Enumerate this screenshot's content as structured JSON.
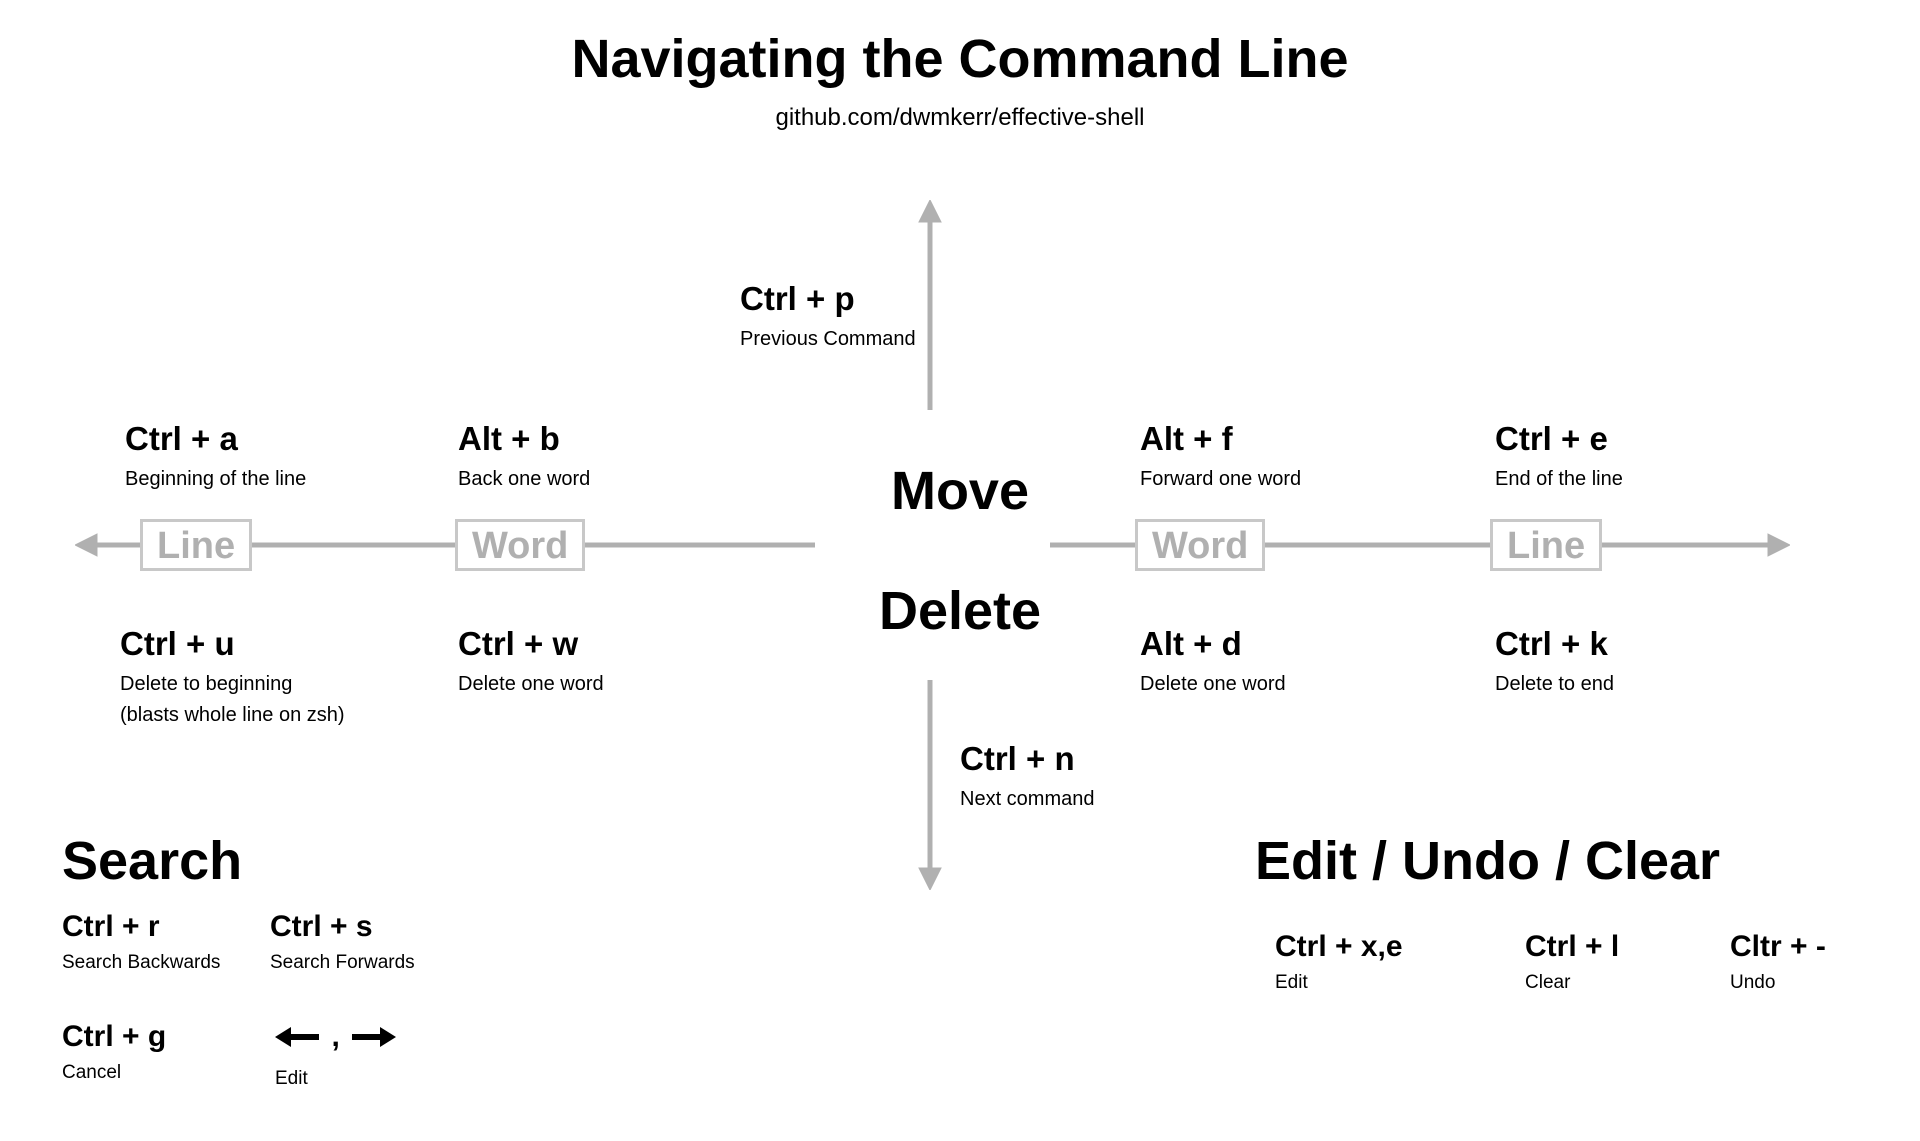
{
  "header": {
    "title": "Navigating the Command Line",
    "subtitle": "github.com/dwmkerr/effective-shell"
  },
  "center": {
    "move": "Move",
    "delete": "Delete"
  },
  "axis_labels": {
    "left_line": "Line",
    "left_word": "Word",
    "right_word": "Word",
    "right_line": "Line"
  },
  "shortcuts": {
    "ctrl_p": {
      "key": "Ctrl + p",
      "desc": "Previous Command"
    },
    "ctrl_n": {
      "key": "Ctrl + n",
      "desc": "Next command"
    },
    "ctrl_a": {
      "key": "Ctrl + a",
      "desc": "Beginning of the line"
    },
    "alt_b": {
      "key": "Alt + b",
      "desc": "Back one word"
    },
    "alt_f": {
      "key": "Alt + f",
      "desc": "Forward one word"
    },
    "ctrl_e": {
      "key": "Ctrl + e",
      "desc": "End of the line"
    },
    "ctrl_u": {
      "key": "Ctrl + u",
      "desc": "Delete to beginning",
      "desc2": "(blasts whole line on zsh)"
    },
    "ctrl_w": {
      "key": "Ctrl + w",
      "desc": "Delete one word"
    },
    "alt_d": {
      "key": "Alt + d",
      "desc": "Delete one word"
    },
    "ctrl_k": {
      "key": "Ctrl + k",
      "desc": "Delete to end"
    }
  },
  "sections": {
    "search": {
      "title": "Search",
      "items": {
        "ctrl_r": {
          "key": "Ctrl + r",
          "desc": "Search Backwards"
        },
        "ctrl_s": {
          "key": "Ctrl + s",
          "desc": "Search Forwards"
        },
        "ctrl_g": {
          "key": "Ctrl + g",
          "desc": "Cancel"
        },
        "arrows": {
          "key": "← , →",
          "desc": "Edit"
        }
      }
    },
    "edit": {
      "title": "Edit / Undo / Clear",
      "items": {
        "ctrl_xe": {
          "key": "Ctrl + x,e",
          "desc": "Edit"
        },
        "ctrl_l": {
          "key": "Ctrl + l",
          "desc": "Clear"
        },
        "cltr_dash": {
          "key": "Cltr + -",
          "desc": "Undo"
        }
      }
    }
  }
}
